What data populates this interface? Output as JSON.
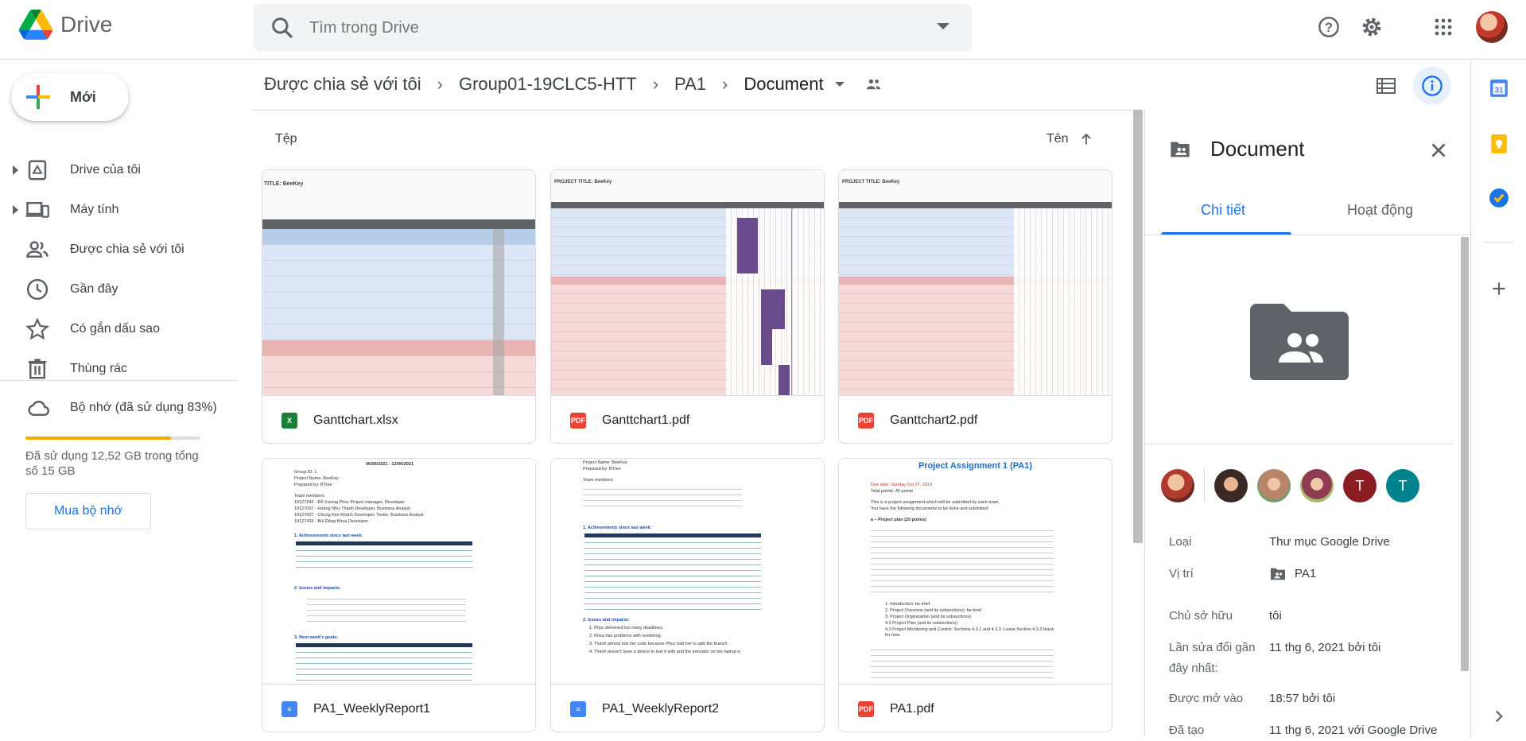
{
  "app": {
    "name": "Drive"
  },
  "search": {
    "placeholder": "Tìm trong Drive"
  },
  "sidebar": {
    "new_label": "Mới",
    "items": [
      {
        "label": "Drive của tôi",
        "icon": "my-drive-icon"
      },
      {
        "label": "Máy tính",
        "icon": "computers-icon"
      },
      {
        "label": "Được chia sẻ với tôi",
        "icon": "shared-icon"
      },
      {
        "label": "Gần đây",
        "icon": "recent-icon"
      },
      {
        "label": "Có gắn dấu sao",
        "icon": "star-icon"
      },
      {
        "label": "Thùng rác",
        "icon": "trash-icon"
      }
    ],
    "storage": {
      "label": "Bộ nhớ (đã sử dụng 83%)",
      "used_percent": 83,
      "text": "Đã sử dụng 12,52 GB trong tổng số 15 GB",
      "buy_label": "Mua bộ nhớ"
    }
  },
  "breadcrumb": [
    "Được chia sẻ với tôi",
    "Group01-19CLC5-HTT",
    "PA1",
    "Document"
  ],
  "main": {
    "section_label": "Tệp",
    "sort_label": "Tên",
    "files": [
      {
        "name": "Ganttchart.xlsx",
        "type": "xlsx"
      },
      {
        "name": "Ganttchart1.pdf",
        "type": "pdf"
      },
      {
        "name": "Ganttchart2.pdf",
        "type": "pdf"
      },
      {
        "name": "PA1_WeeklyReport1",
        "type": "doc"
      },
      {
        "name": "PA1_WeeklyReport2",
        "type": "doc"
      },
      {
        "name": "PA1.pdf",
        "type": "pdf"
      }
    ],
    "thumb_texts": {
      "xlsx_title": "TITLE: BeeKey",
      "pdf_title": "PROJECT TITLE: BeeKey",
      "report1_date": "06/06/2021 - 12/06/2021",
      "report1_group": "Group ID: 1",
      "report1_project": "Project Name: BeeKey",
      "report1_prepared": "Prepared by: BTree",
      "report1_members": "Team members",
      "report1_m1": "19127242 - Đỗ Vương Phúc Project manager, Developer",
      "report1_m2": "19127007 - Hoàng Như Thanh Developer, Business Analyst",
      "report1_m3": "19127007 - Chung Kim Khánh Developer, Tester, Business Analyst",
      "report1_m4": "19127433 - Bùi Đăng Khoa Developer",
      "report1_h1": "1. Achievements since last week:",
      "report1_h2": "2. Issues and impacts:",
      "report1_h3": "3. Next week's goals:",
      "report2_project": "Project Name: BeeKey",
      "report2_prepared": "Prepared by: BTree",
      "report2_members": "Team members",
      "report2_h1": "1. Achievements since last week:",
      "report2_h2": "2. Issues and impacts:",
      "report2_i1": "1. Phuc delivered too many deadlines.",
      "report2_i2": "2. Khoa has problems with rendering.",
      "report2_i3": "3. Thanh almost lost her code because Phuc told her to split the branch.",
      "report2_i4": "4. Thanh doesn't have a device to test it with and the emulator on her laptop is",
      "pa1_title": "Project Assignment 1 (PA1)",
      "pa1_due": "Due date: Sunday Oct 27, 2019",
      "pa1_points": "Total points: 45 points",
      "pa1_p1": "This is a project assignment which will be submitted by each team.",
      "pa1_p2": "You have the following documents to be done and submitted:",
      "pa1_a": "a – Project plan (20 points)",
      "pa1_b1": "1. Introduction: be brief",
      "pa1_b2": "2. Project Overview (and its subsections): be brief",
      "pa1_b3": "3. Project Organization (and its subsections)",
      "pa1_b4": "4.2 Project Plan (and its subsections)",
      "pa1_b5": "4.3 Project Monitoring and Control: Sections 4.3.1 and 4.3.3. Leave Section 4.3.2 blank for now."
    }
  },
  "details": {
    "title": "Document",
    "tab_details": "Chi tiết",
    "tab_activity": "Hoạt động",
    "avatars": [
      "",
      "",
      "",
      "",
      "T",
      "T"
    ],
    "rows": [
      {
        "key": "Loại",
        "value": "Thư mục Google Drive"
      },
      {
        "key": "Vị trí",
        "value": "PA1"
      },
      {
        "key": "Chủ sở hữu",
        "value": "tôi"
      },
      {
        "key": "Lần sửa đổi gần đây nhất:",
        "value": "11 thg 6, 2021 bởi tôi"
      },
      {
        "key": "Được mở vào",
        "value": "18:57 bởi tôi"
      },
      {
        "key": "Đã tạo",
        "value": "11 thg 6, 2021 với Google Drive"
      }
    ]
  },
  "colors": {
    "accent": "#1a73e8",
    "storage": "#f9ab00",
    "pdf": "#ea4335",
    "sheet": "#188038",
    "doc": "#4285f4"
  }
}
